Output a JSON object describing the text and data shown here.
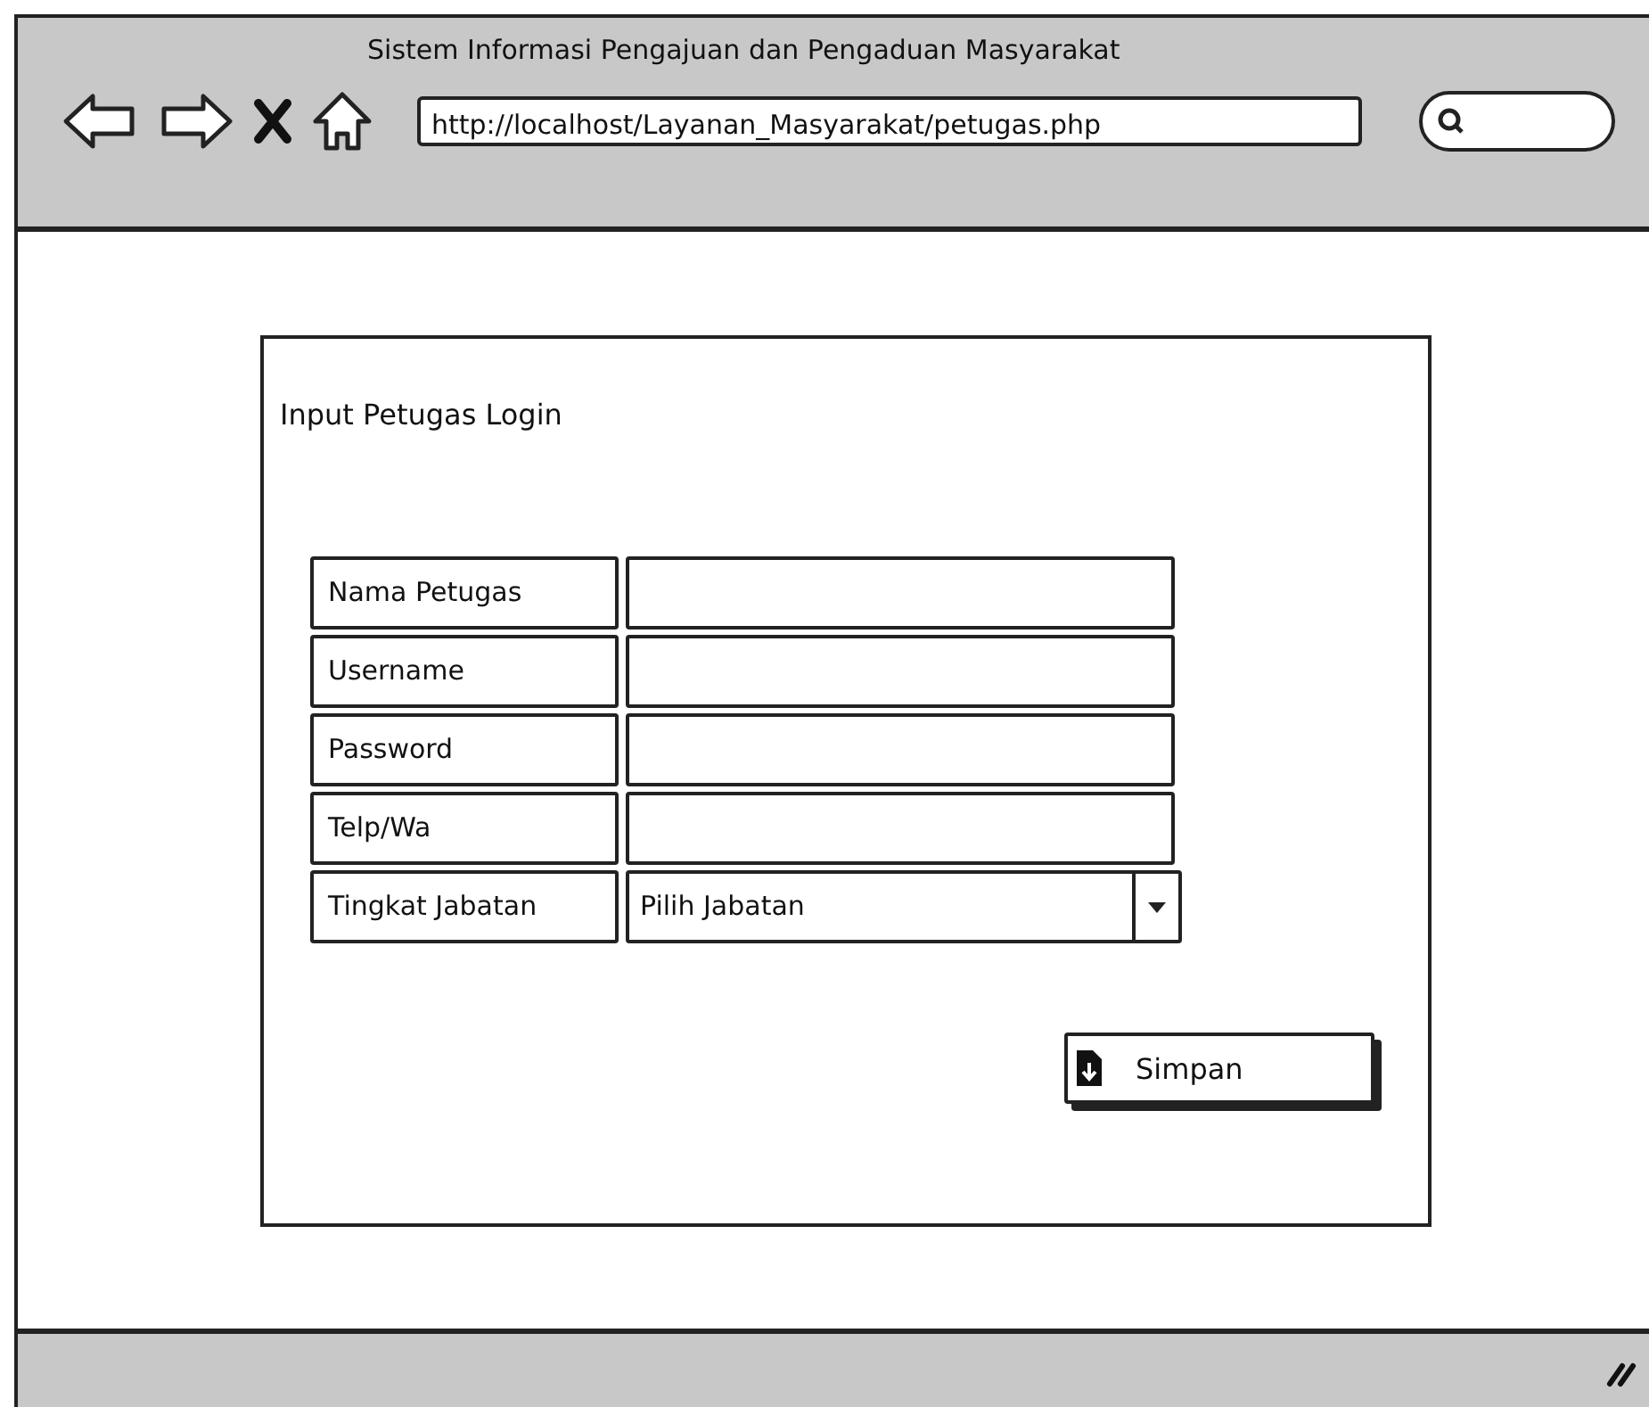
{
  "window": {
    "title": "Sistem Informasi Pengajuan dan Pengaduan Masyarakat"
  },
  "toolbar": {
    "url": "http://localhost/Layanan_Masyarakat/petugas.php"
  },
  "form": {
    "title": "Input Petugas Login",
    "fields": [
      {
        "kind": "text",
        "label": "Nama Petugas"
      },
      {
        "kind": "text",
        "label": "Username"
      },
      {
        "kind": "text",
        "label": "Password"
      },
      {
        "kind": "text",
        "label": "Telp/Wa"
      },
      {
        "kind": "select",
        "label": "Tingkat Jabatan",
        "value": "Pilih Jabatan"
      }
    ],
    "button": "Simpan"
  }
}
